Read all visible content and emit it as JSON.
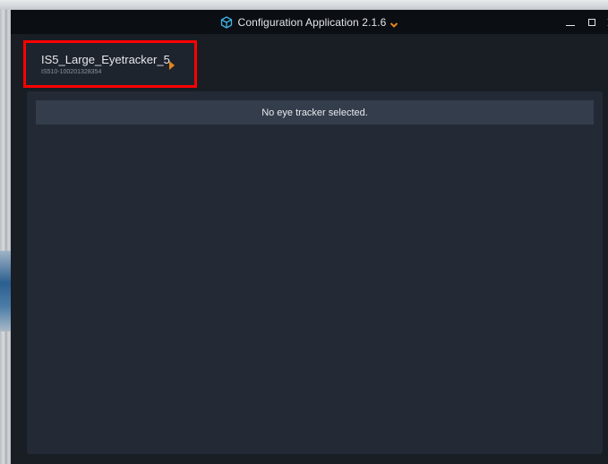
{
  "titlebar": {
    "app_icon": "cube-icon",
    "title": "Configuration Application 2.1.6",
    "chevron_icon": "chevron-down-icon",
    "accent_color": "#e8841a",
    "icon_color": "#3db6e8",
    "minimize_icon": "minimize-icon",
    "maximize_icon": "maximize-icon",
    "close_icon": "close-icon"
  },
  "tracker": {
    "name": "IS5_Large_Eyetracker_5",
    "serial": "IS510-100201328354",
    "arrow_icon": "play-arrow-icon",
    "highlight_color": "#ff0000"
  },
  "main": {
    "message": "No eye tracker selected."
  }
}
